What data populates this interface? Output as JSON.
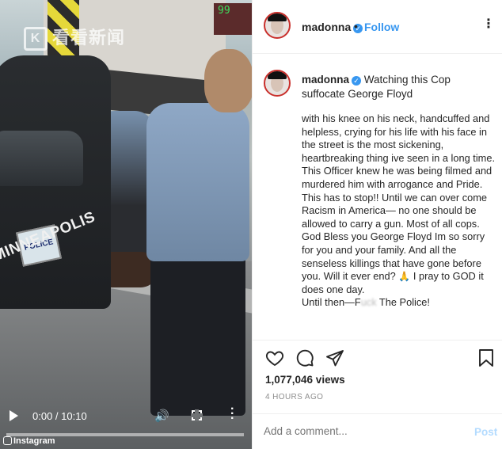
{
  "video": {
    "watermark": "看看新闻",
    "car_text": "MINNEAPOLIS",
    "plate_text": "POLICE",
    "ambulance_number": "99",
    "time": "0:00 / 10:10",
    "progress": 0,
    "platform_label": "Instagram"
  },
  "header": {
    "username": "madonna",
    "separator": "•",
    "follow_label": "Follow",
    "more_glyph": "⋮"
  },
  "caption": {
    "username": "madonna",
    "headline": "Watching this Cop suffocate George Floyd",
    "paragraph1": "with his knee on his neck, handcuffed and helpless, crying for his life with his face in the street is the most sickening, heartbreaking thing ive seen in a long time. This Officer knew he was being filmed and murdered him with arrogance and Pride.",
    "paragraph2": "This has to stop!! Until we can over come Racism in America— no one should be allowed to carry a gun. Most of all cops.",
    "paragraph3_a": "God Bless you George Floyd Im so sorry for you and your family. And all the senseless killings that have gone before you. Will it ever end?",
    "paragraph3_b": "I pray to GOD it does one day.",
    "pray_emoji": "🙏",
    "paragraph4_a": "Until then—F",
    "paragraph4_censored": "uck",
    "paragraph4_b": " The Police!"
  },
  "stats": {
    "views": "1,077,046 views",
    "posted": "4 HOURS AGO"
  },
  "comment": {
    "placeholder": "Add a comment...",
    "post_label": "Post"
  },
  "colors": {
    "link_blue": "#3897f0",
    "post_disabled": "#b3dbff",
    "verified": "#3897f0"
  },
  "icons": [
    "heart-icon",
    "comment-icon",
    "share-icon",
    "bookmark-icon",
    "verified-icon",
    "play-icon",
    "volume-icon",
    "fullscreen-icon",
    "more-icon"
  ]
}
